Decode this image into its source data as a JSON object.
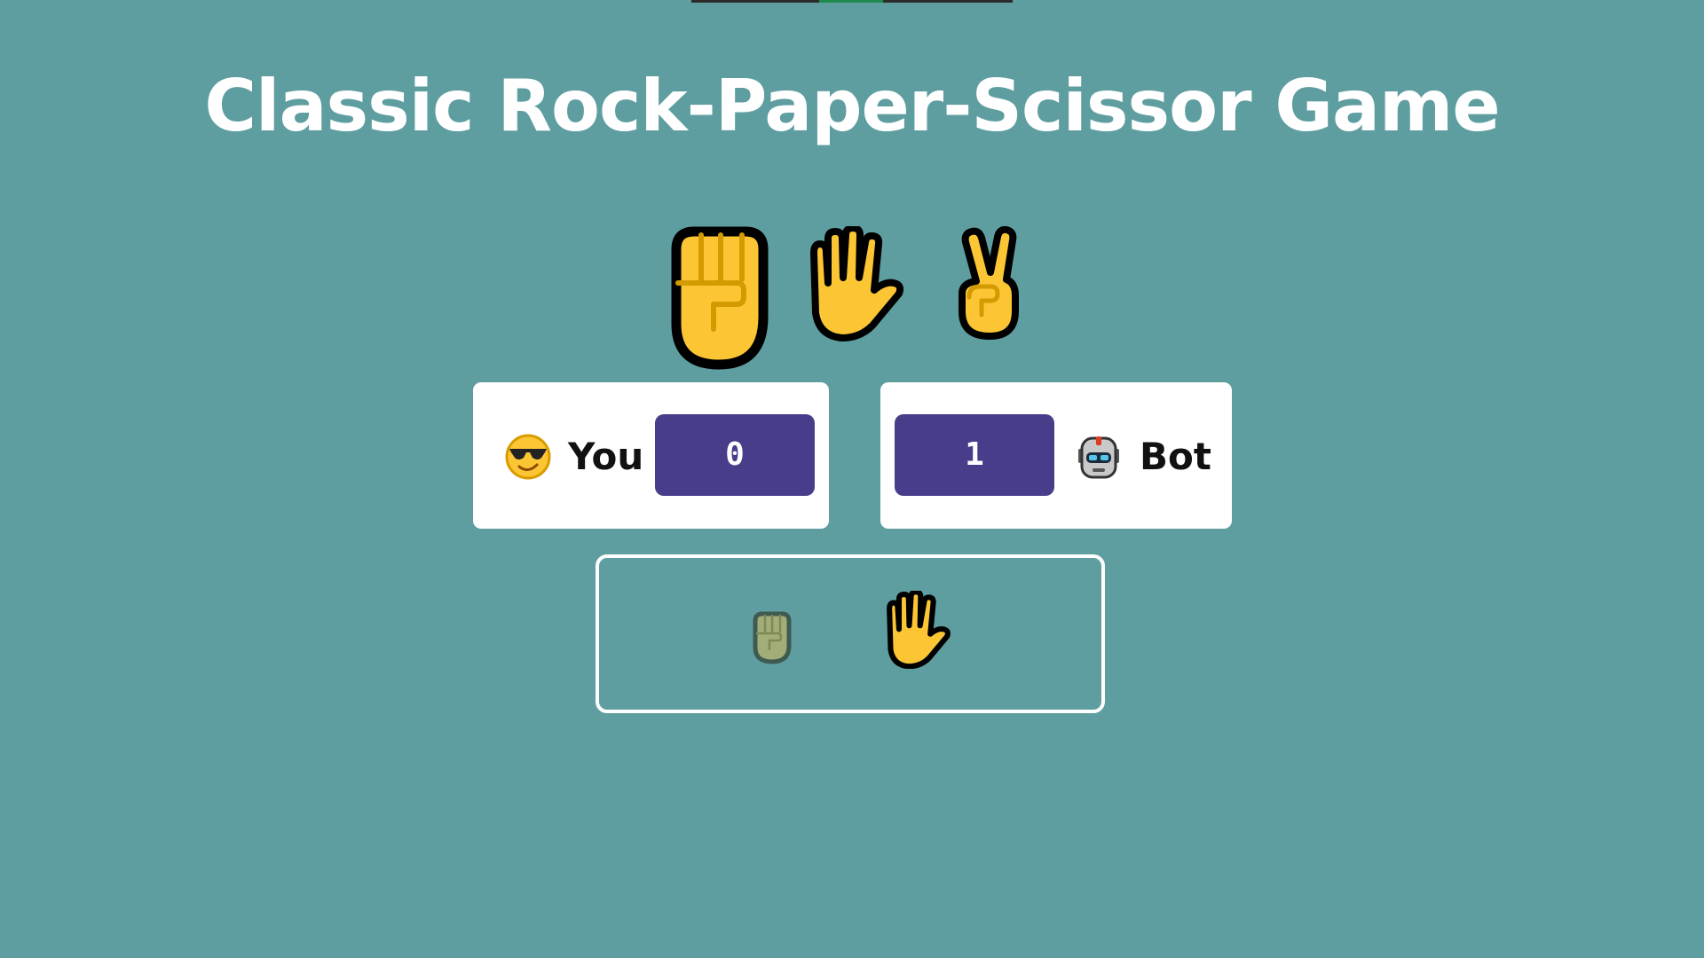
{
  "title": "Classic Rock-Paper-Scissor Game",
  "choices": [
    {
      "name": "rock",
      "icon": "raised-fist-icon",
      "selected": true
    },
    {
      "name": "paper",
      "icon": "raised-hand-icon",
      "selected": false
    },
    {
      "name": "scissor",
      "icon": "victory-hand-icon",
      "selected": false
    }
  ],
  "scoreboard": {
    "user": {
      "label": "You",
      "score": "0",
      "icon": "cool-face-icon"
    },
    "bot": {
      "label": "Bot",
      "score": "1",
      "icon": "robot-icon"
    }
  },
  "result": {
    "user_choice_icon": "raised-fist-icon",
    "bot_choice_icon": "raised-hand-icon"
  },
  "colors": {
    "background": "#5f9ea0",
    "score_box": "#483d8b",
    "card": "#ffffff",
    "emoji_yellow": "#fcc534"
  }
}
